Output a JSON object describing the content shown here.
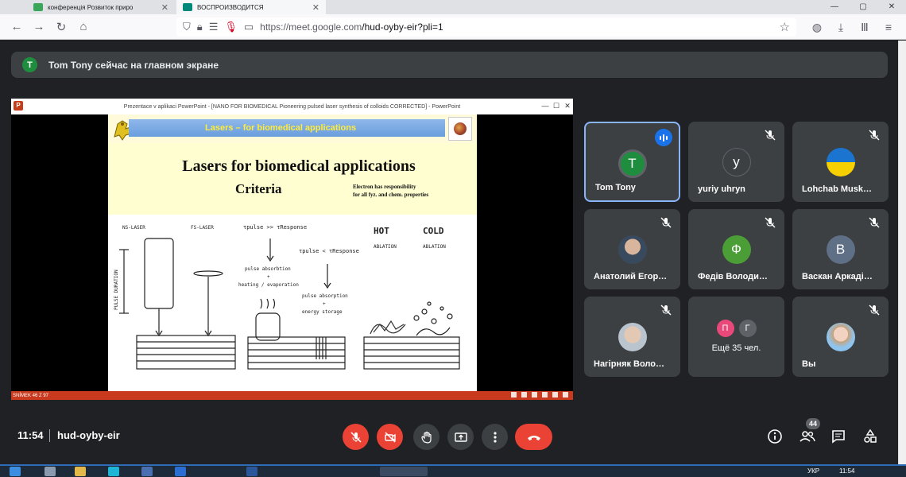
{
  "browser": {
    "tabs": [
      {
        "label": "конференція Розвиток приро",
        "active": false,
        "favicon_color": "#3ba65a"
      },
      {
        "label": "ВОСПРОИЗВОДИТСЯ",
        "active": true,
        "favicon_color": "#00897b"
      }
    ],
    "url_host": "https://meet.google.com",
    "url_path": "/hud-oyby-eir?pli=1"
  },
  "banner": {
    "avatar_letter": "T",
    "text": "Tom Tony сейчас на главном экране"
  },
  "presentation": {
    "window_title": "Prezentace v aplikaci PowerPoint - [NANO FOR BIOMEDICAL Pioneering pulsed laser synthesis of colloids CORRECTED] - PowerPoint",
    "slide_header": "Lasers – for biomedical applications",
    "slide_title": "Lasers for biomedical applications",
    "slide_subtitle": "Criteria",
    "slide_note_line1": "Electron has responsibility",
    "slide_note_line2": "for all fyz. and chem. properties",
    "drawing_labels": {
      "ns": "NS-LASER",
      "fs": "FS-LASER",
      "hot": "HOT",
      "cold": "COLD",
      "ablation1": "ABLATION",
      "ablation2": "ABLATION",
      "pulse_duration": "PULSE DURATION",
      "tpulse1": "τpulse >> τResponse",
      "tpulse2": "τpulse < τResponse",
      "step1a": "pulse absorbtion",
      "step1b": "+",
      "step1c": "heating / evaporation",
      "step2a": "pulse absorption",
      "step2b": "+",
      "step2c": "energy storage"
    },
    "status_left": "SNÍMEK 46 Z 97"
  },
  "participants": [
    {
      "name": "Tom Tony",
      "initial": "T",
      "color": "#1e8e3e",
      "speaking": true,
      "muted": false,
      "active": true
    },
    {
      "name": "yuriy uhryn",
      "initial": "y",
      "color": "#3c4043",
      "muted": true
    },
    {
      "name": "Lohchab Musk…",
      "initial": "",
      "muted": true,
      "image": "ukraine-badge"
    },
    {
      "name": "Анатолий Егор…",
      "initial": "",
      "muted": true,
      "image": "photo-man"
    },
    {
      "name": "Федів Володи…",
      "initial": "Ф",
      "color": "#4b9e36",
      "muted": true
    },
    {
      "name": "Васкан Аркаді…",
      "initial": "В",
      "color": "#5f6f86",
      "muted": true
    },
    {
      "name": "Нагірняк Воло…",
      "initial": "",
      "muted": true,
      "image": "photo-man-grey"
    },
    {
      "name": "Ещё 35 чел.",
      "more": true,
      "initials": [
        "П",
        "Г"
      ],
      "colors": [
        "#e8497a",
        "#5f6368"
      ]
    },
    {
      "name": "Вы",
      "initial": "",
      "muted": true,
      "image": "photo-woman"
    }
  ],
  "bottom": {
    "time": "11:54",
    "meeting_code": "hud-oyby-eir",
    "people_count": "44"
  },
  "taskbar": {
    "lang": "УКР",
    "time": "11:54"
  },
  "colors": {
    "meet_bg": "#202124",
    "tile_bg": "#3c4043",
    "danger": "#ea4335",
    "accent": "#8ab4f8"
  }
}
